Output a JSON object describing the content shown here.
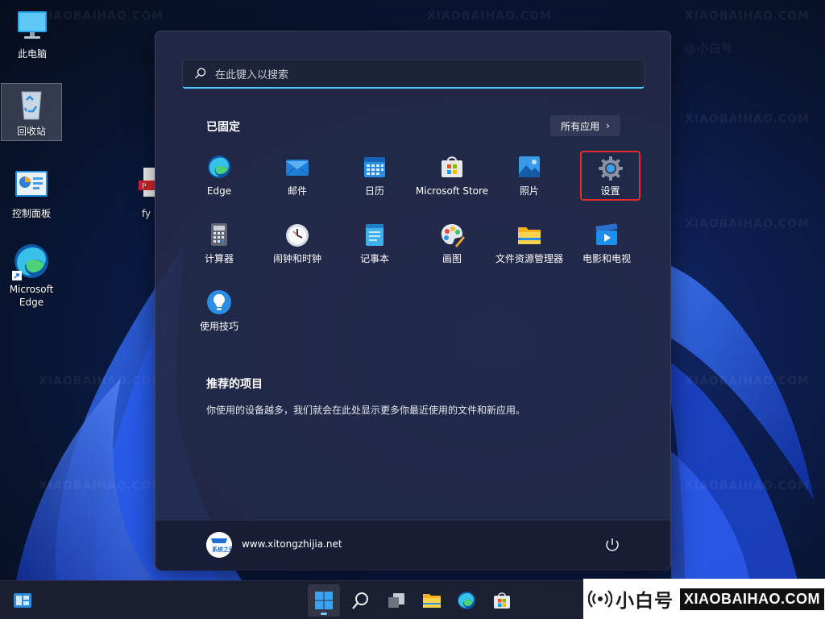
{
  "desktop": {
    "icons": [
      {
        "label": "此电脑"
      },
      {
        "label": "回收站"
      },
      {
        "label": "控制面板"
      },
      {
        "label": "Microsoft\nEdge"
      },
      {
        "label": "fy"
      }
    ],
    "watermark": {
      "cn": "@小白号",
      "en": "XIAOBAIHAO.COM"
    }
  },
  "start_menu": {
    "search": {
      "placeholder": "在此键入以搜索"
    },
    "pinned": {
      "title": "已固定",
      "all_apps_label": "所有应用",
      "apps": [
        {
          "label": "Edge",
          "icon": "edge-icon"
        },
        {
          "label": "邮件",
          "icon": "mail-icon"
        },
        {
          "label": "日历",
          "icon": "calendar-icon"
        },
        {
          "label": "Microsoft Store",
          "icon": "store-icon"
        },
        {
          "label": "照片",
          "icon": "photos-icon"
        },
        {
          "label": "设置",
          "icon": "settings-gear-icon",
          "highlighted": true
        },
        {
          "label": "计算器",
          "icon": "calculator-icon"
        },
        {
          "label": "闹钟和时钟",
          "icon": "clock-icon"
        },
        {
          "label": "记事本",
          "icon": "notepad-icon"
        },
        {
          "label": "画图",
          "icon": "paint-palette-icon"
        },
        {
          "label": "文件资源管理器",
          "icon": "folder-icon"
        },
        {
          "label": "电影和电视",
          "icon": "movies-tv-icon"
        },
        {
          "label": "使用技巧",
          "icon": "tips-lightbulb-icon"
        }
      ]
    },
    "recommended": {
      "title": "推荐的项目",
      "text": "你使用的设备越多，我们就会在此处显示更多你最近使用的文件和新应用。"
    },
    "user": {
      "name": "www.xitongzhijia.net",
      "avatar_text": "系统之家"
    },
    "power_icon": "power-icon"
  },
  "taskbar": {
    "items": [
      "widgets-icon",
      "start-icon",
      "search-icon",
      "task-view-icon",
      "file-explorer-icon",
      "edge-icon",
      "store-icon"
    ]
  },
  "branding": {
    "cn": "小白号",
    "en": "XIAOBAIHAO.COM"
  },
  "colors": {
    "accent": "#4cc2ff",
    "highlight_border": "#e22b2b"
  }
}
